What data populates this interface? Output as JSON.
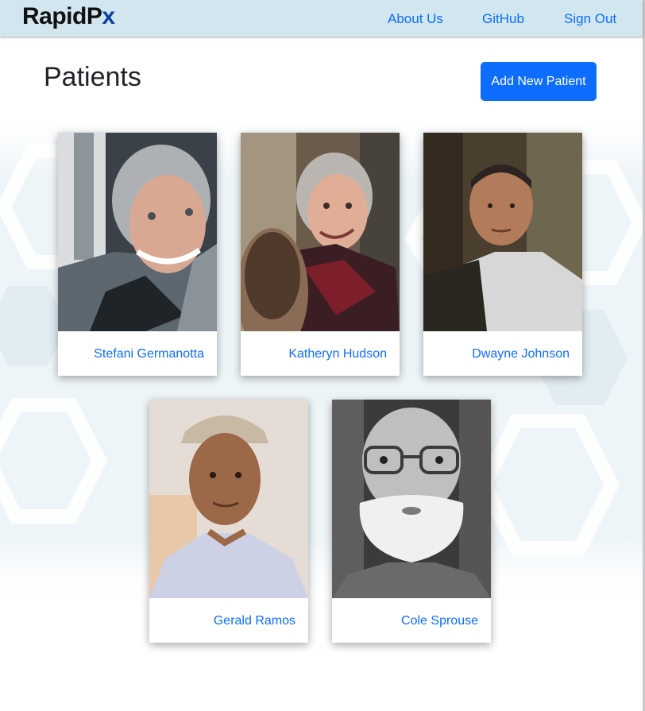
{
  "navbar": {
    "brand_main": "RapidP",
    "brand_accent": "x",
    "links": [
      "About Us",
      "GitHub",
      "Sign Out"
    ]
  },
  "page": {
    "title": "Patients",
    "add_button_label": "Add New Patient"
  },
  "patients": [
    {
      "name": "Stefani Germanotta"
    },
    {
      "name": "Katheryn Hudson"
    },
    {
      "name": "Dwayne Johnson"
    },
    {
      "name": "Gerald Ramos"
    },
    {
      "name": "Cole Sprouse"
    }
  ],
  "colors": {
    "navbar_bg": "#d1e6ef",
    "brand_accent": "#0a3ea3",
    "link": "#0d6efd",
    "button": "#0d6efd"
  }
}
